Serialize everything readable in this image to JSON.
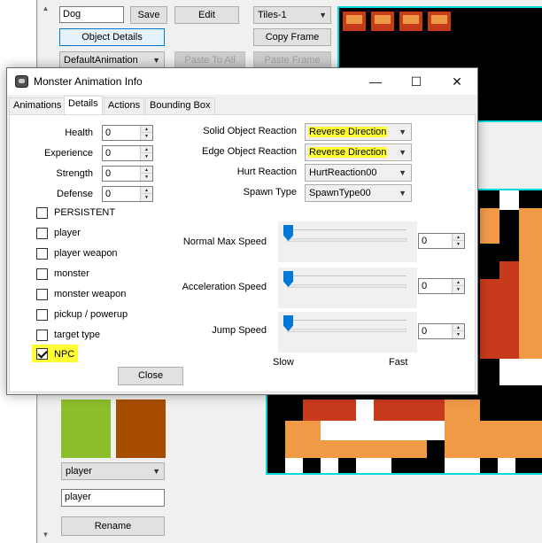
{
  "editor": {
    "name_value": "Dog",
    "save_label": "Save",
    "edit_label": "Edit",
    "tileset_value": "Tiles-1",
    "object_details_label": "Object Details",
    "copy_frame_label": "Copy Frame",
    "animation_value": "DefaultAnimation",
    "paste_to_all_label": "Paste To All",
    "paste_frame_label": "Paste Frame",
    "type_combo_value": "player",
    "name_field_value": "player",
    "rename_label": "Rename",
    "swatch_colors": [
      "#8cbd2a",
      "#a74d00"
    ]
  },
  "dialog": {
    "title": "Monster Animation Info",
    "tabs": [
      {
        "label": "Animations",
        "active": false
      },
      {
        "label": "Details",
        "active": true
      },
      {
        "label": "Actions",
        "active": false
      },
      {
        "label": "Bounding Box",
        "active": false
      }
    ],
    "stats": [
      {
        "label": "Health",
        "value": "0"
      },
      {
        "label": "Experience",
        "value": "0"
      },
      {
        "label": "Strength",
        "value": "0"
      },
      {
        "label": "Defense",
        "value": "0"
      }
    ],
    "flags": [
      {
        "label": "PERSISTENT",
        "checked": false
      },
      {
        "label": "player",
        "checked": false
      },
      {
        "label": "player weapon",
        "checked": false
      },
      {
        "label": "monster",
        "checked": false
      },
      {
        "label": "monster weapon",
        "checked": false
      },
      {
        "label": "pickup / powerup",
        "checked": false
      },
      {
        "label": "target type",
        "checked": false
      },
      {
        "label": "NPC",
        "checked": true
      }
    ],
    "reactions": [
      {
        "label": "Solid Object Reaction",
        "value": "Reverse Direction",
        "highlight": true
      },
      {
        "label": "Edge Object Reaction",
        "value": "Reverse Direction",
        "highlight": true
      },
      {
        "label": "Hurt Reaction",
        "value": "HurtReaction00",
        "highlight": false
      },
      {
        "label": "Spawn Type",
        "value": "SpawnType00",
        "highlight": false
      }
    ],
    "speeds": [
      {
        "label": "Normal Max Speed",
        "value": "0",
        "level": 0
      },
      {
        "label": "Acceleration Speed",
        "value": "0",
        "level": 0
      },
      {
        "label": "Jump Speed",
        "value": "0",
        "level": 0
      }
    ],
    "slow_label": "Slow",
    "fast_label": "Fast",
    "close_label": "Close",
    "highlight_color": "#ffff33"
  }
}
